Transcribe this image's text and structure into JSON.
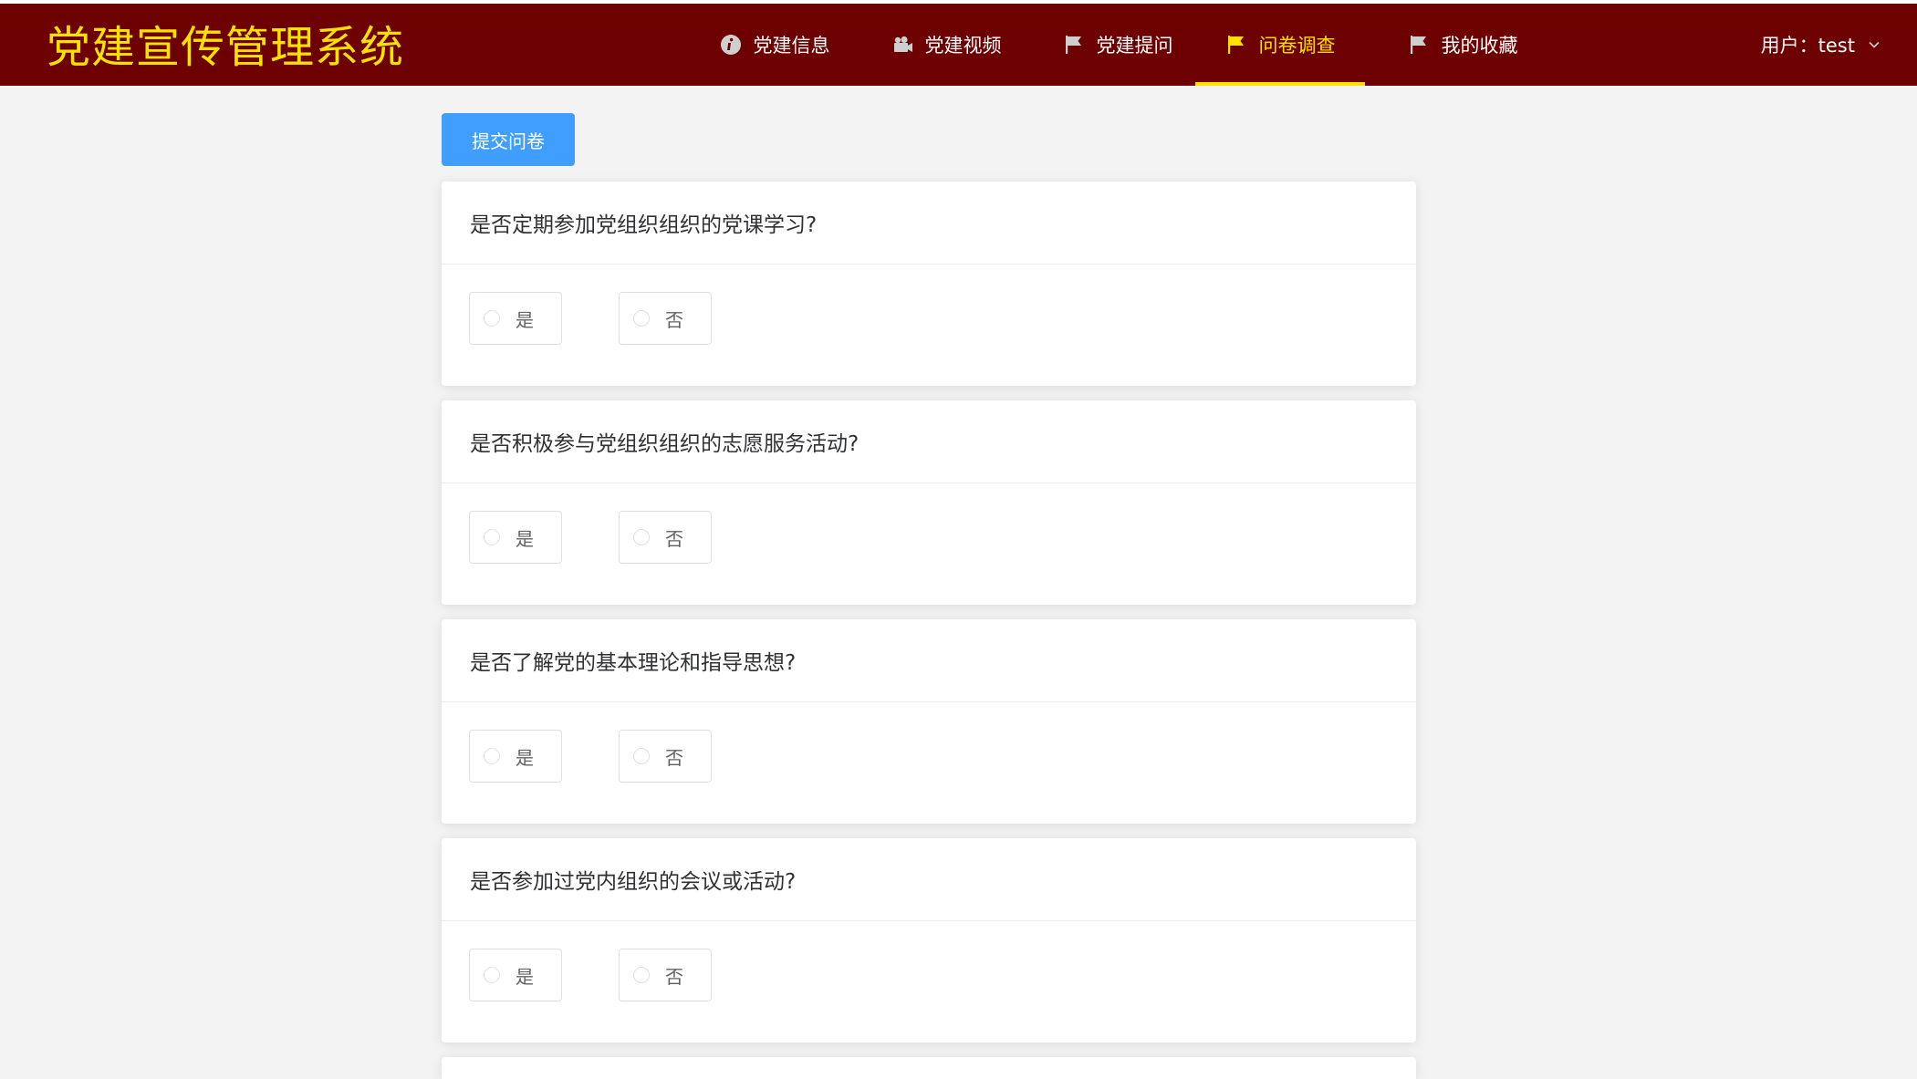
{
  "app": {
    "title": "党建宣传管理系统"
  },
  "nav": {
    "items": [
      {
        "label": "党建信息",
        "icon": "info-icon"
      },
      {
        "label": "党建视频",
        "icon": "video-camera-icon"
      },
      {
        "label": "党建提问",
        "icon": "flag-icon"
      },
      {
        "label": "问卷调查",
        "icon": "flag-icon",
        "active": true
      },
      {
        "label": "我的收藏",
        "icon": "flag-icon"
      }
    ]
  },
  "user": {
    "label": "用户：test"
  },
  "toolbar": {
    "submit_label": "提交问卷"
  },
  "questions": [
    {
      "text": "是否定期参加党组织组织的党课学习?",
      "options": [
        "是",
        "否"
      ]
    },
    {
      "text": "是否积极参与党组织组织的志愿服务活动?",
      "options": [
        "是",
        "否"
      ]
    },
    {
      "text": "是否了解党的基本理论和指导思想?",
      "options": [
        "是",
        "否"
      ]
    },
    {
      "text": "是否参加过党内组织的会议或活动?",
      "options": [
        "是",
        "否"
      ]
    }
  ],
  "colors": {
    "header_bg": "#6d0000",
    "brand": "#ffe100",
    "active_nav": "#ffe100",
    "primary": "#409eff",
    "page_bg": "#f3f3f3"
  }
}
